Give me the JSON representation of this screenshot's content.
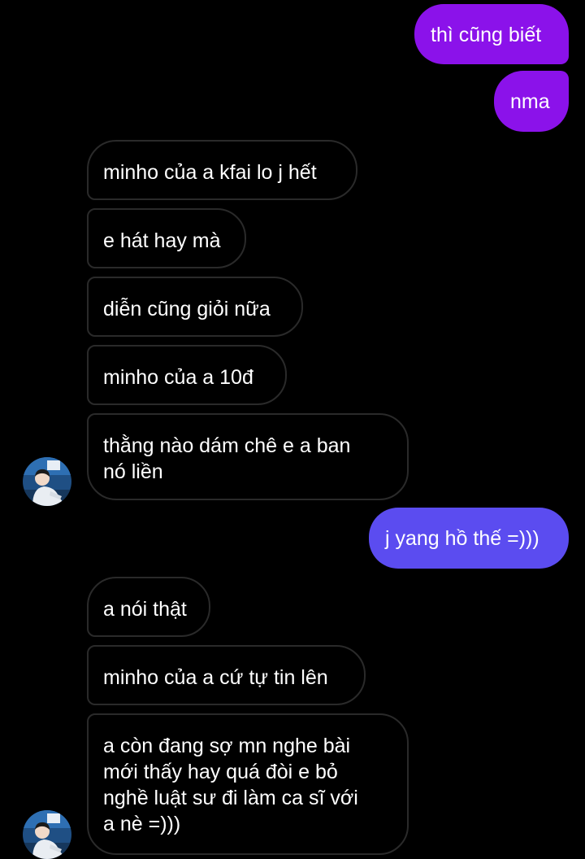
{
  "colors": {
    "background": "#000000",
    "sent_purple": "#8b12ea",
    "sent_indigo": "#5b4cf0",
    "received_border": "#2a2a2a",
    "text": "#ffffff"
  },
  "avatar": {
    "icon": "profile-photo-icon"
  },
  "messages": [
    {
      "direction": "sent",
      "text": "thì cũng biết"
    },
    {
      "direction": "sent",
      "text": "nma"
    },
    {
      "direction": "received",
      "text": "minho của a kfai lo j hết"
    },
    {
      "direction": "received",
      "text": "e hát hay mà"
    },
    {
      "direction": "received",
      "text": "diễn cũng giỏi nữa"
    },
    {
      "direction": "received",
      "text": "minho của a 10đ"
    },
    {
      "direction": "received",
      "text": "thằng nào dám chê e a ban\nnó liền"
    },
    {
      "direction": "sent",
      "text": "j yang hồ thế =)))"
    },
    {
      "direction": "received",
      "text": "a nói thật"
    },
    {
      "direction": "received",
      "text": "minho của a cứ tự tin lên"
    },
    {
      "direction": "received",
      "text": "a còn đang sợ mn nghe bài\nmới thấy hay quá đòi e bỏ\nnghề luật sư đi làm ca sĩ với\na nè =)))"
    }
  ]
}
